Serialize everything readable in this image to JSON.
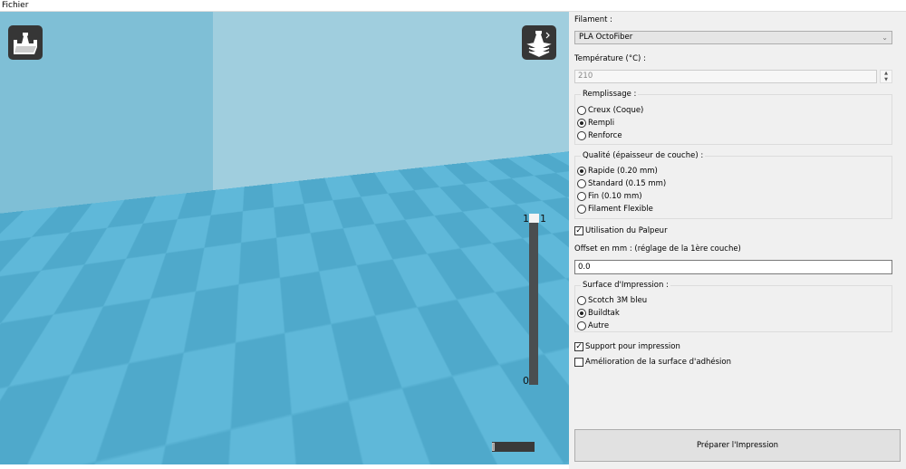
{
  "menu": {
    "file": "Fichier"
  },
  "viewport": {
    "layer_slider": {
      "top_left": "1",
      "top_right": "1",
      "bottom": "0",
      "value_fraction": 1.0
    },
    "progress": {
      "value_fraction": 0.05
    },
    "icons": {
      "open": "open-folder-icon",
      "view": "layers-view-icon"
    },
    "colors": {
      "floor_light": "#5fb8d9",
      "floor_dark": "#4fa9cb",
      "wall_left": "#7fbfd6",
      "wall_right": "#a0cede"
    }
  },
  "panel": {
    "filament_label": "Filament :",
    "filament_value": "PLA OctoFiber",
    "temperature_label": "Température (°C) :",
    "temperature_value": "210",
    "infill": {
      "title": "Remplissage :",
      "options": [
        "Creux (Coque)",
        "Rempli",
        "Renforce"
      ],
      "selected": 1
    },
    "quality": {
      "title": "Qualité (épaisseur de couche) :",
      "options": [
        "Rapide (0.20 mm)",
        "Standard (0.15 mm)",
        "Fin (0.10 mm)",
        "Filament Flexible"
      ],
      "selected": 0
    },
    "probe": {
      "label": "Utilisation du Palpeur",
      "checked": true
    },
    "offset_label": "Offset en mm : (réglage de la 1ère couche)",
    "offset_value": "0.0",
    "surface": {
      "title": "Surface d'Impression :",
      "options": [
        "Scotch 3M bleu",
        "Buildtak",
        "Autre"
      ],
      "selected": 1
    },
    "support": {
      "label": "Support pour impression",
      "checked": true
    },
    "adhesion": {
      "label": "Amélioration de la surface d'adhésion",
      "checked": false
    },
    "prepare_button": "Préparer l'Impression"
  }
}
